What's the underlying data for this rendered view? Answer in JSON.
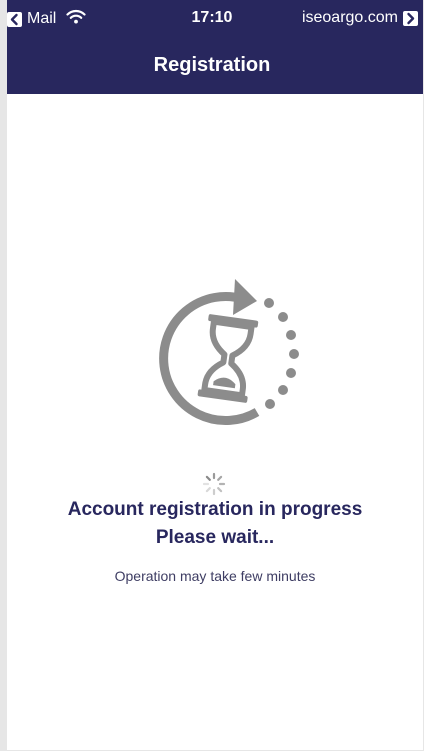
{
  "status_bar": {
    "back_app": "Mail",
    "time": "17:10",
    "url": "iseoargo.com"
  },
  "header": {
    "title": "Registration"
  },
  "main": {
    "title": "Account registration in progress",
    "wait_text": "Please wait...",
    "subtitle": "Operation may take few minutes"
  },
  "colors": {
    "header_bg": "#28275e",
    "text_primary": "#28275e",
    "icon_gray": "#8c8c8c"
  },
  "icons": {
    "back": "chevron-left-icon",
    "wifi": "wifi-icon",
    "forward": "chevron-right-icon",
    "illustration": "hourglass-refresh-icon",
    "spinner": "spinner-icon"
  }
}
